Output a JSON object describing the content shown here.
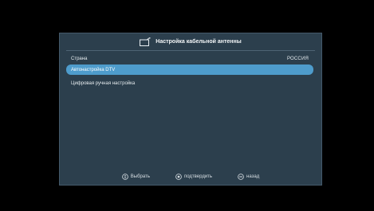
{
  "header": {
    "title": "Настройка кабельной антенны",
    "icon": "tv-antenna-icon"
  },
  "settings": {
    "country_label": "Страна",
    "country_value": "РОССИЯ",
    "items": [
      {
        "label": "Автонастройка DTV",
        "selected": true
      },
      {
        "label": "Цифровая ручная настройка",
        "selected": false
      }
    ]
  },
  "footer": {
    "select_label": "Выбрать",
    "confirm_label": "подтвердить",
    "back_label": "назад"
  },
  "colors": {
    "panel": "#2c3f4d",
    "highlight": "#4e9ccc",
    "background": "#000000"
  }
}
